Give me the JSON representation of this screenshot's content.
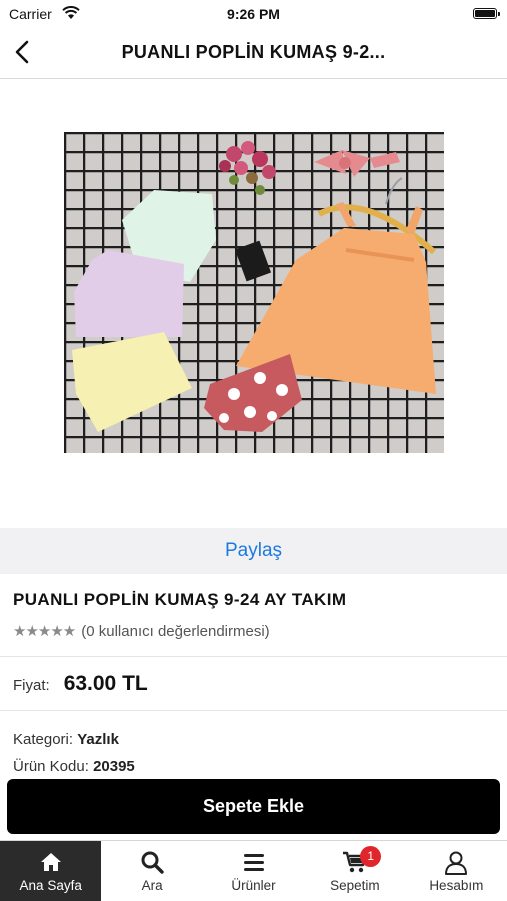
{
  "status_bar": {
    "carrier": "Carrier",
    "time": "9:26 PM"
  },
  "nav": {
    "title": "PUANLI POPLİN KUMAŞ 9-2..."
  },
  "share": {
    "label": "Paylaş",
    "color": "#1b7ae0"
  },
  "product": {
    "name": "PUANLI POPLİN KUMAŞ 9-24 AY TAKIM",
    "rating_stars": 5,
    "rating_text": "(0 kullanıcı değerlendirmesi)",
    "price_label": "Fiyat:",
    "price_value": "63.00 TL",
    "category_label": "Kategori:",
    "category_value": "Yazlık",
    "code_label": "Ürün Kodu:",
    "code_value": "20395"
  },
  "cart_button": {
    "label": "Sepete Ekle"
  },
  "tabbar": {
    "items": [
      {
        "label": "Ana Sayfa",
        "icon": "home-icon",
        "active": true
      },
      {
        "label": "Ara",
        "icon": "search-icon"
      },
      {
        "label": "Ürünler",
        "icon": "menu-icon"
      },
      {
        "label": "Sepetim",
        "icon": "cart-icon",
        "badge": "1"
      },
      {
        "label": "Hesabım",
        "icon": "user-icon"
      }
    ]
  }
}
